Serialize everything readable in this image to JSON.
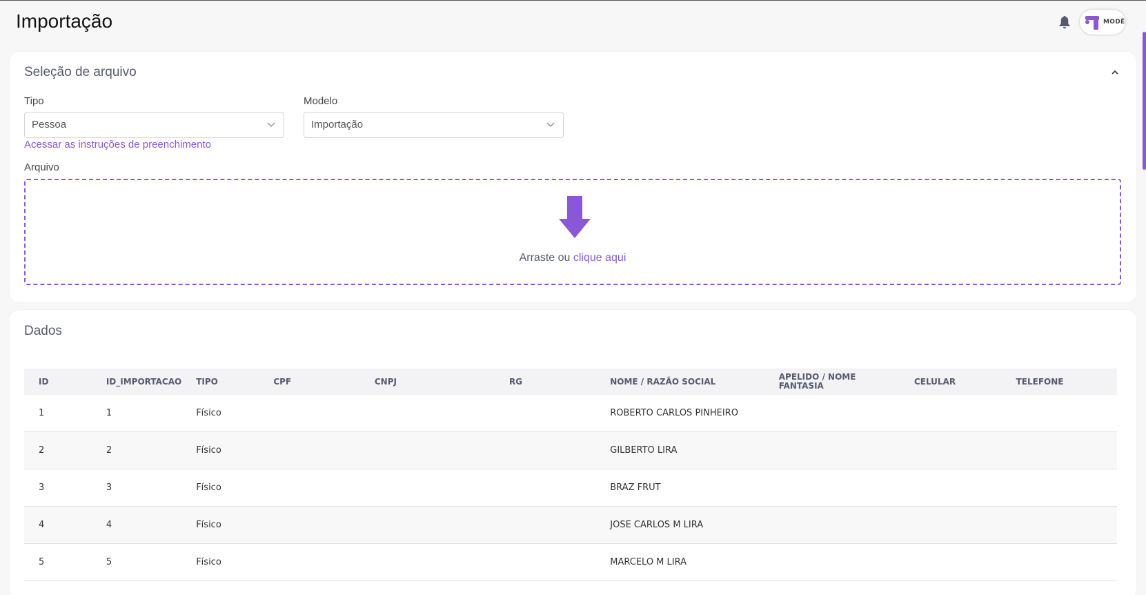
{
  "header": {
    "title": "Importação",
    "bell_icon": "bell-icon",
    "brand_text": "MODÊ"
  },
  "file_selection": {
    "title": "Seleção de arquivo",
    "tipo_label": "Tipo",
    "tipo_value": "Pessoa",
    "modelo_label": "Modelo",
    "modelo_value": "Importação",
    "instructions_link": "Acessar as instruções de preenchimento",
    "arquivo_label": "Arquivo",
    "drop_text": "Arraste ou",
    "drop_click": "clique aqui"
  },
  "data_section": {
    "title": "Dados",
    "columns": [
      "ID",
      "ID_IMPORTACAO",
      "TIPO",
      "CPF",
      "CNPJ",
      "RG",
      "NOME / RAZÃO SOCIAL",
      "APELIDO / NOME FANTASIA",
      "CELULAR",
      "TELEFONE"
    ],
    "rows": [
      {
        "id": "1",
        "id_importacao": "1",
        "tipo": "Físico",
        "cpf": "",
        "cnpj": "",
        "rg": "",
        "nome": "ROBERTO CARLOS PINHEIRO",
        "apelido": "",
        "celular": "",
        "telefone": ""
      },
      {
        "id": "2",
        "id_importacao": "2",
        "tipo": "Físico",
        "cpf": "",
        "cnpj": "",
        "rg": "",
        "nome": "GILBERTO LIRA",
        "apelido": "",
        "celular": "",
        "telefone": ""
      },
      {
        "id": "3",
        "id_importacao": "3",
        "tipo": "Físico",
        "cpf": "",
        "cnpj": "",
        "rg": "",
        "nome": "BRAZ FRUT",
        "apelido": "",
        "celular": "",
        "telefone": ""
      },
      {
        "id": "4",
        "id_importacao": "4",
        "tipo": "Físico",
        "cpf": "",
        "cnpj": "",
        "rg": "",
        "nome": "JOSE CARLOS M LIRA",
        "apelido": "",
        "celular": "",
        "telefone": ""
      },
      {
        "id": "5",
        "id_importacao": "5",
        "tipo": "Físico",
        "cpf": "",
        "cnpj": "",
        "rg": "",
        "nome": "MARCELO M LIRA",
        "apelido": "",
        "celular": "",
        "telefone": ""
      }
    ]
  },
  "colors": {
    "accent": "#8a57d6",
    "background": "#f7f7f8"
  }
}
